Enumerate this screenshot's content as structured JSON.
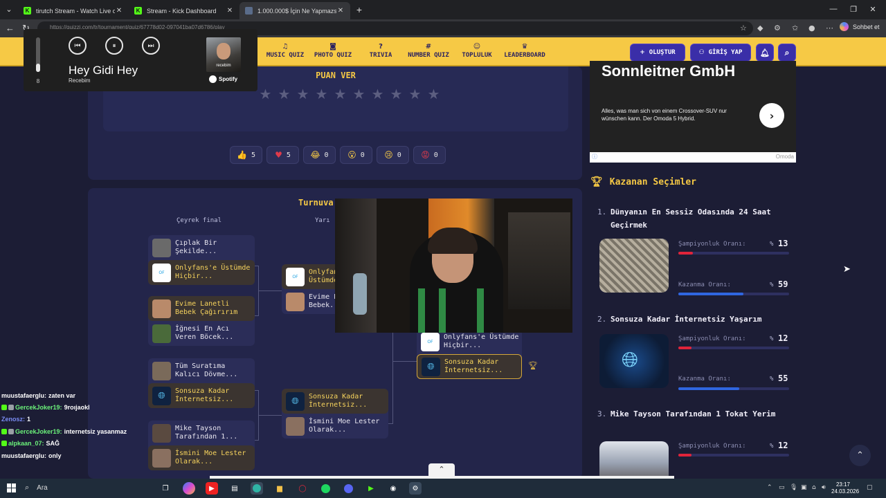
{
  "browser": {
    "tabs": [
      {
        "title": "tirutch Stream - Watch Live on Ki...",
        "favicon_color": "#53fc18"
      },
      {
        "title": "Stream - Kick Dashboard",
        "favicon_color": "#53fc18"
      },
      {
        "title": "1.000.000$ İçin Ne Yapmazsın - Ti...",
        "favicon_color": "#5a6c8a"
      }
    ],
    "url": "https://quizzi.com/tr/tournament/quiz/67778d02-097041ba07d6786/play",
    "chat_button": "Sohbet et"
  },
  "site": {
    "nav": [
      {
        "label": "MUSIC QUIZ",
        "icon": "music-note-icon",
        "glyph": "♫"
      },
      {
        "label": "PHOTO QUIZ",
        "icon": "camera-icon",
        "glyph": "◙"
      },
      {
        "label": "TRIVIA",
        "icon": "question-circle-icon",
        "glyph": "?"
      },
      {
        "label": "NUMBER QUIZ",
        "icon": "hash-icon",
        "glyph": "#"
      },
      {
        "label": "TOPLULUK",
        "icon": "people-icon",
        "glyph": "☺"
      },
      {
        "label": "LEADERBOARD",
        "icon": "trophy-icon",
        "glyph": "♛"
      }
    ],
    "create_button": "OLUŞTUR",
    "login_button": "GİRİŞ YAP"
  },
  "spotify": {
    "song": "Hey Gidi Hey",
    "artist": "Recebim",
    "album_label": "recebim",
    "brand": "Spotify",
    "volume": 8,
    "volume_fraction": 0.25
  },
  "rating": {
    "title": "PUAN VER",
    "stars_total": 10,
    "stars_filled": 0
  },
  "reactions": [
    {
      "icon": "thumbs-up-icon",
      "glyph": "👍",
      "count": "5",
      "color": "#f6c945"
    },
    {
      "icon": "heart-icon",
      "glyph": "♥",
      "count": "5",
      "color": "#e03a4a"
    },
    {
      "icon": "laugh-icon",
      "glyph": "😂",
      "count": "0",
      "color": "#f6c945"
    },
    {
      "icon": "surprised-icon",
      "glyph": "😮",
      "count": "0",
      "color": "#f6c945"
    },
    {
      "icon": "sad-icon",
      "glyph": "😢",
      "count": "0",
      "color": "#f6c945"
    },
    {
      "icon": "angry-icon",
      "glyph": "😡",
      "count": "0",
      "color": "#e03a4a"
    }
  ],
  "bracket": {
    "title": "Turnuva",
    "quarter_label": "Çeyrek final",
    "semi_label": "Yarı",
    "quarter_matches": [
      [
        {
          "name": "Çıplak Bir Şekilde...",
          "thumb": "#6a6a6a",
          "winner": false
        },
        {
          "name": "Onlyfans'e Üstümde Hiçbir...",
          "thumb": "#ffffff",
          "thumb_text": "OnlyFans",
          "winner": true
        }
      ],
      [
        {
          "name": "Evime Lanetli Bebek Çağırırım",
          "thumb": "#b98a6a",
          "winner": true
        },
        {
          "name": "İğnesi En Acı Veren Böcek...",
          "thumb": "#4a6a3a",
          "winner": false
        }
      ],
      [
        {
          "name": "Tüm Suratıma Kalıcı Dövme...",
          "thumb": "#7a6a5a",
          "winner": false
        },
        {
          "name": "Sonsuza Kadar İnternetsiz...",
          "thumb": "#0f2240",
          "winner": true
        }
      ],
      [
        {
          "name": "Mike Tayson Tarafından 1...",
          "thumb": "#5a4a40",
          "winner": false
        },
        {
          "name": "İsmini Moe Lester Olarak...",
          "thumb": "#8a7060",
          "winner": true
        }
      ]
    ],
    "semi_matches": [
      [
        {
          "name": "Onlyfans'e Üstümde...",
          "thumb": "#ffffff",
          "winner": true
        },
        {
          "name": "Evime Lanetli Bebek...",
          "thumb": "#b98a6a",
          "winner": false
        }
      ],
      [
        {
          "name": "Sonsuza Kadar İnternetsiz...",
          "thumb": "#0f2240",
          "winner": true
        },
        {
          "name": "İsmini Moe Lester Olarak...",
          "thumb": "#8a7060",
          "winner": false
        }
      ]
    ],
    "final_match": [
      {
        "name": "Onlyfans'e Üstümde Hiçbir...",
        "thumb": "#ffffff",
        "winner": false
      },
      {
        "name": "Sonsuza Kadar İnternetsiz...",
        "thumb": "#0f2240",
        "winner": true
      }
    ]
  },
  "ad": {
    "headline": "Sonnleitner GmbH",
    "body": "Alles, was man sich von einem Crossover-SUV nur wünschen kann. Der Omoda 5 Hybrid.",
    "brand": "Omoda"
  },
  "winners": {
    "title": "Kazanan Seçimler",
    "champ_label": "Şampiyonluk Oranı:",
    "win_label": "Kazanma Oranı:",
    "pct_sign": "%",
    "champ_color": "#e0243a",
    "win_color": "#2f66e0",
    "items": [
      {
        "rank": "1.",
        "title": "Dünyanın En Sessiz Odasında 24 Saat Geçirmek",
        "champ": 13,
        "win": 59,
        "image": "anechoic-room"
      },
      {
        "rank": "2.",
        "title": "Sonsuza Kadar İnternetsiz Yaşarım",
        "champ": 12,
        "win": 55,
        "image": "globe"
      },
      {
        "rank": "3.",
        "title": "Mike Tayson Tarafından 1 Tokat Yerim",
        "champ": 12,
        "win": null,
        "image": "portrait"
      }
    ]
  },
  "chat": [
    {
      "user": "muustafaerglu:",
      "text": "zaten var",
      "color": "#ffffff",
      "badges": []
    },
    {
      "user": "GercekJoker19:",
      "text": "9roıjaokl",
      "color": "#6bf27a",
      "badges": [
        "#53fc18",
        "#9aa0a6"
      ]
    },
    {
      "user": "Zenosz:",
      "text": "1",
      "color": "#7a8cf2",
      "badges": []
    },
    {
      "user": "GercekJoker19:",
      "text": "internetsiz yasanmaz",
      "color": "#6bf27a",
      "badges": [
        "#53fc18",
        "#9aa0a6"
      ]
    },
    {
      "user": "alpkaan_07:",
      "text": "SAĞ",
      "color": "#6bf27a",
      "badges": [
        "#53fc18"
      ]
    },
    {
      "user": "muustafaerglu:",
      "text": "only",
      "color": "#ffffff",
      "badges": []
    }
  ],
  "taskbar": {
    "search": "Ara",
    "time": "23:17",
    "date": "24.03.2026"
  }
}
